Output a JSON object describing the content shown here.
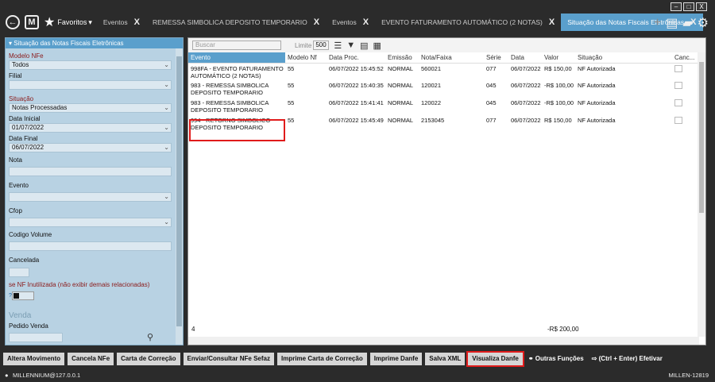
{
  "window": {
    "minimize": "–",
    "maximize": "□",
    "close": "X"
  },
  "topbar": {
    "back_icon": "back-arrow-icon",
    "logo": "M",
    "favorites": "Favoritos",
    "tabs": [
      {
        "label": "Eventos",
        "close": "X"
      },
      {
        "label": "REMESSA SIMBOLICA DEPOSITO TEMPORARIO",
        "close": "X"
      },
      {
        "label": "Eventos",
        "close": "X"
      },
      {
        "label": "EVENTO FATURAMENTO AUTOMÁTICO (2 NOTAS)",
        "close": "X"
      },
      {
        "label": "Situação das Notas Fiscais Eletrônicas",
        "close": "X",
        "active": true
      }
    ]
  },
  "sidebar": {
    "title": "Situação das Notas Fiscais Eletrônicas",
    "modelo_label": "Modelo NFe",
    "modelo_value": "Todos",
    "filial_label": "Filial",
    "situacao_label": "Situação",
    "situacao_value": "Notas Processadas",
    "data_inicial_label": "Data Inicial",
    "data_inicial_value": "01/07/2022",
    "data_final_label": "Data Final",
    "data_final_value": "06/07/2022",
    "nota_label": "Nota",
    "evento_label": "Evento",
    "cfop_label": "Cfop",
    "codigo_volume_label": "Codigo Volume",
    "cancelada_label": "Cancelada",
    "inutilizada_label": "se NF Inutilizada (não exibir demais relacionadas)",
    "venda_label": "Venda",
    "pedido_label": "Pedido Venda"
  },
  "toolbar": {
    "search_placeholder": "Buscar",
    "limit_label": "Limite",
    "limit_value": "500"
  },
  "table": {
    "headers": [
      "Evento",
      "Modelo Nf",
      "Data Proc.",
      "Emissão",
      "Nota/Faixa",
      "Série",
      "Data",
      "Valor",
      "Situação",
      "Canc..."
    ],
    "rows": [
      [
        "998FA - EVENTO FATURAMENTO AUTOMÁTICO (2 NOTAS)",
        "55",
        "06/07/2022 15:45:52",
        "NORMAL",
        "560021",
        "077",
        "06/07/2022",
        "R$ 150,00",
        "NF Autorizada"
      ],
      [
        "983 - REMESSA SIMBOLICA DEPOSITO TEMPORARIO",
        "55",
        "06/07/2022 15:40:35",
        "NORMAL",
        "120021",
        "045",
        "06/07/2022",
        "-R$ 100,00",
        "NF Autorizada"
      ],
      [
        "983 - REMESSA SIMBOLICA DEPOSITO TEMPORARIO",
        "55",
        "06/07/2022 15:41:41",
        "NORMAL",
        "120022",
        "045",
        "06/07/2022",
        "-R$ 100,00",
        "NF Autorizada"
      ],
      [
        "994 - RETORNO SIMBOLICO DEPOSITO TEMPORARIO",
        "55",
        "06/07/2022 15:45:49",
        "NORMAL",
        "2153045",
        "077",
        "06/07/2022",
        "R$ 150,00",
        "NF Autorizada"
      ]
    ],
    "count": "4",
    "total": "-R$ 200,00"
  },
  "actions": [
    "Altera Movimento",
    "Cancela NFe",
    "Carta de Correção",
    "Enviar/Consultar NFe Sefaz",
    "Imprime Carta de Correção",
    "Imprime Danfe",
    "Salva XML",
    "Visualiza Danfe",
    "Outras Funções",
    "(Ctrl + Enter) Efetivar"
  ],
  "status": {
    "left": "MILLENNIUM@127.0.0.1",
    "right": "MILLEN-12819"
  },
  "colors": {
    "accent": "#5a9fcc",
    "highlight": "#e01b1b"
  }
}
